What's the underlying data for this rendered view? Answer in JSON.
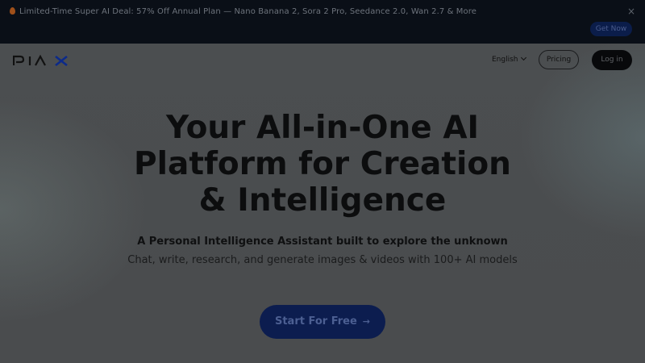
{
  "promo": {
    "text": "Limited-Time Super AI Deal: 57% Off Annual Plan — Nano Banana 2, Sora 2 Pro, Seedance 2.0, Wan 2.7 & More",
    "close": "×",
    "cta": "Get Now"
  },
  "nav": {
    "logo": "PIAX",
    "language": "English",
    "pricing": "Pricing",
    "login": "Log in"
  },
  "hero": {
    "title_line1": "Your All-in-One AI",
    "title_line2": "Platform for Creation",
    "title_line3": "& Intelligence",
    "subtitle": "A Personal Intelligence Assistant built to explore the unknown",
    "description": "Chat, write, research, and generate images & videos with 100+ AI models",
    "cta": "Start For Free",
    "cta_arrow": "→"
  },
  "colors": {
    "banner_bg": "#0a0f17",
    "page_bg": "#4a4c4f",
    "accent": "#0c1d4f"
  }
}
